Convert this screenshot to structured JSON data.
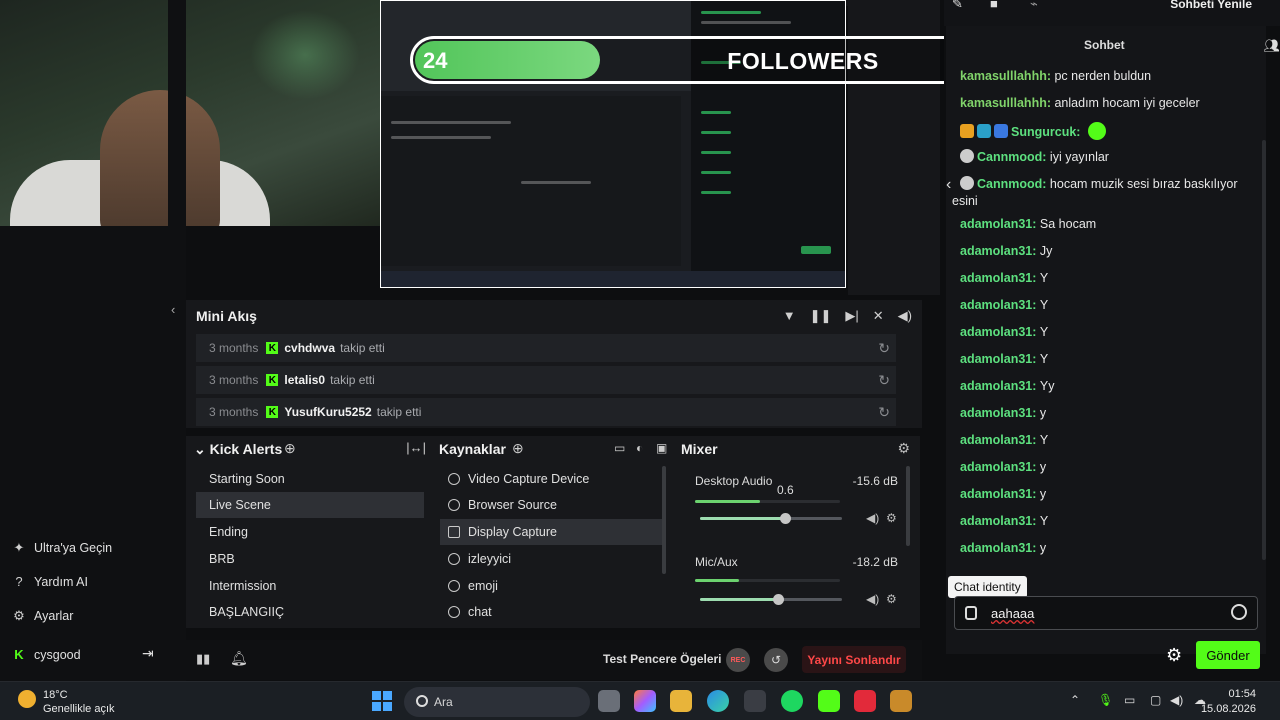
{
  "followers": {
    "current": "24",
    "label": "FOLLOWERS",
    "goal": "100"
  },
  "chat_header": {
    "title": "Sohbet",
    "refresh": "Sohbeti Yenile"
  },
  "mini_feed": {
    "title": "Mini Akış",
    "events": [
      {
        "time": "3 months",
        "user": "cvhdwva",
        "action": "takip etti"
      },
      {
        "time": "3 months",
        "user": "letalis0",
        "action": "takip etti"
      },
      {
        "time": "3 months",
        "user": "YusufKuru5252",
        "action": "takip etti"
      }
    ]
  },
  "scenes": {
    "title": "Kick Alerts",
    "items": [
      "Starting Soon",
      "Live Scene",
      "Ending",
      "BRB",
      "Intermission",
      "BAŞLANGIIÇ"
    ],
    "active_index": 1
  },
  "sources": {
    "title": "Kaynaklar",
    "items": [
      "Video Capture Device",
      "Browser Source",
      "Display Capture",
      "izleyyici",
      "emoji",
      "chat"
    ],
    "active_index": 2
  },
  "mixer": {
    "title": "Mixer",
    "tracks": [
      {
        "name": "Desktop Audio",
        "db": "-15.6 dB",
        "volume_label": "0.6",
        "volume": 0.6,
        "level": 0.45
      },
      {
        "name": "Mic/Aux",
        "db": "-18.2 dB",
        "volume": 0.55,
        "level": 0.3
      }
    ]
  },
  "left_menu": {
    "items": [
      {
        "icon": "sparkle-icon",
        "label": "Ultra'ya Geçin"
      },
      {
        "icon": "help-icon",
        "label": "Yardım AI"
      },
      {
        "icon": "gear-icon",
        "label": "Ayarlar"
      }
    ],
    "account": "cysgood"
  },
  "bottom_bar": {
    "test_label": "Test Pencere Ögeleri",
    "rec_label": "REC",
    "end_stream": "Yayını Sonlandır"
  },
  "chat": {
    "messages": [
      {
        "user": "kamasulllahhh",
        "text": "pc nerden buldun"
      },
      {
        "user": "kamasulllahhh",
        "text": "anladım hocam iyi geceler"
      },
      {
        "user": "Sungurcuk",
        "text": ""
      },
      {
        "user": "Cannmood",
        "text": "iyi yayınlar"
      },
      {
        "user": "Cannmood",
        "text": "hocam muzik sesi bıraz baskılıyor",
        "cont": "esini"
      },
      {
        "user": "adamolan31",
        "text": "Sa hocam"
      },
      {
        "user": "adamolan31",
        "text": "Jy"
      },
      {
        "user": "adamolan31",
        "text": "Y"
      },
      {
        "user": "adamolan31",
        "text": "Y"
      },
      {
        "user": "adamolan31",
        "text": "Y"
      },
      {
        "user": "adamolan31",
        "text": "Y"
      },
      {
        "user": "adamolan31",
        "text": "Yy"
      },
      {
        "user": "adamolan31",
        "text": "y"
      },
      {
        "user": "adamolan31",
        "text": "Y"
      },
      {
        "user": "adamolan31",
        "text": "y"
      },
      {
        "user": "adamolan31",
        "text": "y"
      },
      {
        "user": "adamolan31",
        "text": "Y"
      },
      {
        "user": "adamolan31",
        "text": "y"
      }
    ],
    "tooltip": "Chat identity",
    "input_value": "aahaaa",
    "send_label": "Gönder"
  },
  "taskbar": {
    "temp": "18°C",
    "weather": "Genellikle açık",
    "search_placeholder": "Ara",
    "time": "01:54",
    "date": "15.08.2026"
  },
  "colors": {
    "kick_green": "#53fc18",
    "end_red": "#ff4848",
    "progress_green": "#5cc862"
  }
}
